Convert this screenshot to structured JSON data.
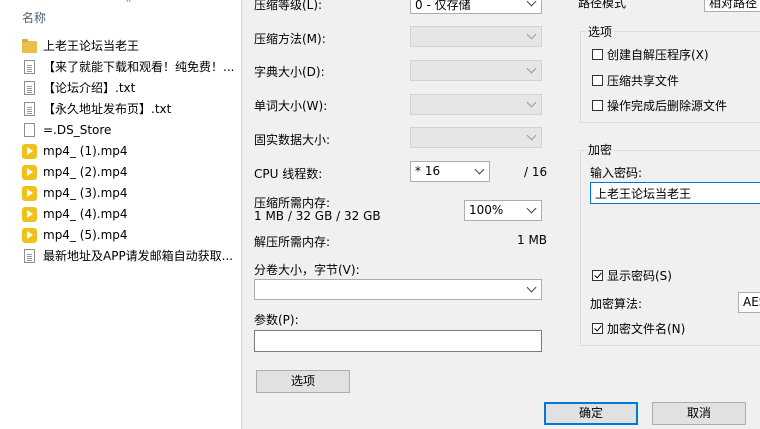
{
  "explorer": {
    "column_name": "名称",
    "files": [
      {
        "name": "上老王论坛当老王",
        "icon": "folder-icon"
      },
      {
        "name": "【来了就能下载和观看！纯免费！...",
        "icon": "text-file-icon"
      },
      {
        "name": "【论坛介绍】.txt",
        "icon": "text-file-icon"
      },
      {
        "name": "【永久地址发布页】.txt",
        "icon": "text-file-icon"
      },
      {
        "name": "=.DS_Store",
        "icon": "blank-file-icon"
      },
      {
        "name": "mp4_ (1).mp4",
        "icon": "video-file-icon"
      },
      {
        "name": "mp4_ (2).mp4",
        "icon": "video-file-icon"
      },
      {
        "name": "mp4_ (3).mp4",
        "icon": "video-file-icon"
      },
      {
        "name": "mp4_ (4).mp4",
        "icon": "video-file-icon"
      },
      {
        "name": "mp4_ (5).mp4",
        "icon": "video-file-icon"
      },
      {
        "name": "最新地址及APP请发邮箱自动获取...",
        "icon": "text-file-icon"
      }
    ]
  },
  "dialog": {
    "compression_level_label": "压缩等级(L):",
    "compression_level_value": "0 - 仅存储",
    "compression_method_label": "压缩方法(M):",
    "dictionary_size_label": "字典大小(D):",
    "word_size_label": "单词大小(W):",
    "solid_block_label": "固实数据大小:",
    "cpu_threads_label": "CPU 线程数:",
    "cpu_threads_value": "* 16",
    "cpu_threads_total": "/ 16",
    "memory_compress_label": "压缩所需内存:",
    "memory_compress_value": "1 MB / 32 GB / 32 GB",
    "memory_percent_value": "100%",
    "memory_decompress_label": "解压所需内存:",
    "memory_decompress_value": "1 MB",
    "split_volume_label": "分卷大小，字节(V):",
    "split_volume_value": "",
    "parameters_label": "参数(P):",
    "parameters_value": "",
    "options_button": "选项",
    "path_mode_label": "路径模式",
    "path_mode_value": "相对路径",
    "options_group": {
      "title": "选项",
      "items": [
        {
          "label": "创建自解压程序(X)",
          "checked": false
        },
        {
          "label": "压缩共享文件",
          "checked": false
        },
        {
          "label": "操作完成后删除源文件",
          "checked": false
        }
      ]
    },
    "encryption_group": {
      "title": "加密",
      "password_label": "输入密码:",
      "password_value": "上老王论坛当老王",
      "show_password_label": "显示密码(S)",
      "show_password_checked": true,
      "method_label": "加密算法:",
      "method_value": "AES",
      "encrypt_names_label": "加密文件名(N)",
      "encrypt_names_checked": true
    },
    "ok_button": "确定",
    "cancel_button": "取消"
  }
}
